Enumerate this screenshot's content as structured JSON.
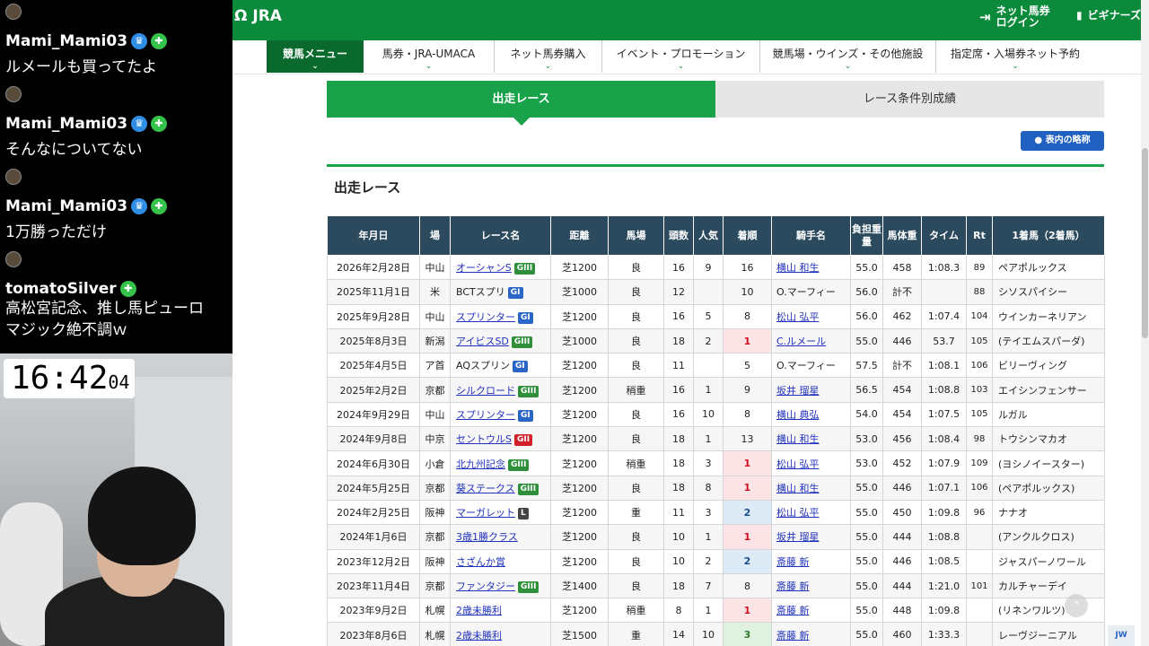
{
  "chat": {
    "messages": [
      {
        "user": "Mami_Mami03",
        "text": "ルメールも買ってたよ"
      },
      {
        "user": "Mami_Mami03",
        "text": "そんなについてない"
      },
      {
        "user": "Mami_Mami03",
        "text": "1万勝っただけ"
      },
      {
        "user": "tomatoSilver",
        "text_lines": [
          "高松宮記念、推し馬ピューロ",
          "マジック絶不調ｗ"
        ]
      }
    ],
    "clock": {
      "time": "16:42",
      "seconds": "04"
    }
  },
  "header": {
    "logo": "JRA",
    "login_line1": "ネット馬券",
    "login_line2": "ログイン",
    "beginner": "ビギナーズ"
  },
  "nav": {
    "items": [
      "競馬メニュー",
      "馬券・JRA-UMACA",
      "ネット馬券購入",
      "イベント・プロモーション",
      "競馬場・ウインズ・その他施設",
      "指定席・入場券ネット予約"
    ]
  },
  "tabs": {
    "entries": "出走レース",
    "results": "レース条件別成績"
  },
  "legend_button": "表内の略称",
  "section_title": "出走レース",
  "table": {
    "headers": [
      "年月日",
      "場",
      "レース名",
      "距離",
      "馬場",
      "頭数",
      "人気",
      "着順",
      "騎手名",
      "負担重量",
      "馬体重",
      "タイム",
      "Rt",
      "1着馬（2着馬）"
    ],
    "rows": [
      {
        "date": "2026年2月28日",
        "venue": "中山",
        "race": "オーシャンS",
        "grade": "GIII",
        "race_link": true,
        "distance": "芝1200",
        "going": "良",
        "runners": "16",
        "pop": "9",
        "pos": "16",
        "jockey": "横山 和生",
        "jockey_link": true,
        "weight": "55.0",
        "body": "458",
        "time": "1:08.3",
        "rt": "89",
        "winner": "ペアポルックス"
      },
      {
        "date": "2025年11月1日",
        "venue": "米",
        "race": "BCTスプリ",
        "grade": "GI",
        "race_link": false,
        "distance": "芝1000",
        "going": "良",
        "runners": "12",
        "pop": "",
        "pos": "10",
        "jockey": "O.マーフィー",
        "jockey_link": false,
        "weight": "56.0",
        "body": "計不",
        "time": "",
        "rt": "88",
        "winner": "シソスパイシー"
      },
      {
        "date": "2025年9月28日",
        "venue": "中山",
        "race": "スプリンター",
        "grade": "GI",
        "race_link": true,
        "distance": "芝1200",
        "going": "良",
        "runners": "16",
        "pop": "5",
        "pos": "8",
        "jockey": "松山 弘平",
        "jockey_link": true,
        "weight": "56.0",
        "body": "462",
        "time": "1:07.4",
        "rt": "104",
        "winner": "ウインカーネリアン"
      },
      {
        "date": "2025年8月3日",
        "venue": "新潟",
        "race": "アイビスSD",
        "grade": "GIII",
        "race_link": true,
        "distance": "芝1000",
        "going": "良",
        "runners": "18",
        "pop": "2",
        "pos": "1",
        "jockey": "C.ルメール",
        "jockey_link": true,
        "weight": "55.0",
        "body": "446",
        "time": "53.7",
        "rt": "105",
        "winner": "(テイエムスパーダ)"
      },
      {
        "date": "2025年4月5日",
        "venue": "ア首",
        "race": "AQスプリン",
        "grade": "GI",
        "race_link": false,
        "distance": "芝1200",
        "going": "良",
        "runners": "11",
        "pop": "",
        "pos": "5",
        "jockey": "O.マーフィー",
        "jockey_link": false,
        "weight": "57.5",
        "body": "計不",
        "time": "1:08.1",
        "rt": "106",
        "winner": "ビリーヴィング"
      },
      {
        "date": "2025年2月2日",
        "venue": "京都",
        "race": "シルクロード",
        "grade": "GIII",
        "race_link": true,
        "distance": "芝1200",
        "going": "稍重",
        "runners": "16",
        "pop": "1",
        "pos": "9",
        "jockey": "坂井 瑠星",
        "jockey_link": true,
        "weight": "56.5",
        "body": "454",
        "time": "1:08.8",
        "rt": "103",
        "winner": "エイシンフェンサー"
      },
      {
        "date": "2024年9月29日",
        "venue": "中山",
        "race": "スプリンター",
        "grade": "GI",
        "race_link": true,
        "distance": "芝1200",
        "going": "良",
        "runners": "16",
        "pop": "10",
        "pos": "8",
        "jockey": "横山 典弘",
        "jockey_link": true,
        "weight": "54.0",
        "body": "454",
        "time": "1:07.5",
        "rt": "105",
        "winner": "ルガル"
      },
      {
        "date": "2024年9月8日",
        "venue": "中京",
        "race": "セントウルS",
        "grade": "GII",
        "race_link": true,
        "distance": "芝1200",
        "going": "良",
        "runners": "18",
        "pop": "1",
        "pos": "13",
        "jockey": "横山 和生",
        "jockey_link": true,
        "weight": "53.0",
        "body": "456",
        "time": "1:08.4",
        "rt": "98",
        "winner": "トウシンマカオ"
      },
      {
        "date": "2024年6月30日",
        "venue": "小倉",
        "race": "北九州記念",
        "grade": "GIII",
        "race_link": true,
        "distance": "芝1200",
        "going": "稍重",
        "runners": "18",
        "pop": "3",
        "pos": "1",
        "jockey": "松山 弘平",
        "jockey_link": true,
        "weight": "53.0",
        "body": "452",
        "time": "1:07.9",
        "rt": "109",
        "winner": "(ヨシノイースター)"
      },
      {
        "date": "2024年5月25日",
        "venue": "京都",
        "race": "葵ステークス",
        "grade": "GIII",
        "race_link": true,
        "distance": "芝1200",
        "going": "良",
        "runners": "18",
        "pop": "8",
        "pos": "1",
        "jockey": "横山 和生",
        "jockey_link": true,
        "weight": "55.0",
        "body": "446",
        "time": "1:07.1",
        "rt": "106",
        "winner": "(ペアポルックス)"
      },
      {
        "date": "2024年2月25日",
        "venue": "阪神",
        "race": "マーガレット",
        "grade": "L",
        "race_link": true,
        "distance": "芝1200",
        "going": "重",
        "runners": "11",
        "pop": "3",
        "pos": "2",
        "jockey": "松山 弘平",
        "jockey_link": true,
        "weight": "55.0",
        "body": "450",
        "time": "1:09.8",
        "rt": "96",
        "winner": "ナナオ"
      },
      {
        "date": "2024年1月6日",
        "venue": "京都",
        "race": "3歳1勝クラス",
        "grade": "",
        "race_link": true,
        "distance": "芝1200",
        "going": "良",
        "runners": "10",
        "pop": "1",
        "pos": "1",
        "jockey": "坂井 瑠星",
        "jockey_link": true,
        "weight": "55.0",
        "body": "444",
        "time": "1:08.8",
        "rt": "",
        "winner": "(アンクルクロス)"
      },
      {
        "date": "2023年12月2日",
        "venue": "阪神",
        "race": "さざんか賞",
        "grade": "",
        "race_link": true,
        "distance": "芝1200",
        "going": "良",
        "runners": "10",
        "pop": "2",
        "pos": "2",
        "jockey": "斎藤 新",
        "jockey_link": true,
        "weight": "55.0",
        "body": "446",
        "time": "1:08.5",
        "rt": "",
        "winner": "ジャスパーノワール"
      },
      {
        "date": "2023年11月4日",
        "venue": "京都",
        "race": "ファンタジー",
        "grade": "GIII",
        "race_link": true,
        "distance": "芝1400",
        "going": "良",
        "runners": "18",
        "pop": "7",
        "pos": "8",
        "jockey": "斎藤 新",
        "jockey_link": true,
        "weight": "55.0",
        "body": "444",
        "time": "1:21.0",
        "rt": "101",
        "winner": "カルチャーデイ"
      },
      {
        "date": "2023年9月2日",
        "venue": "札幌",
        "race": "2歳未勝利",
        "grade": "",
        "race_link": true,
        "distance": "芝1200",
        "going": "稍重",
        "runners": "8",
        "pop": "1",
        "pos": "1",
        "jockey": "斎藤 新",
        "jockey_link": true,
        "weight": "55.0",
        "body": "448",
        "time": "1:09.8",
        "rt": "",
        "winner": "(リネンワルツ)"
      },
      {
        "date": "2023年8月6日",
        "venue": "札幌",
        "race": "2歳未勝利",
        "grade": "",
        "race_link": true,
        "distance": "芝1500",
        "going": "重",
        "runners": "14",
        "pop": "10",
        "pos": "3",
        "jockey": "斎藤 新",
        "jockey_link": true,
        "weight": "55.0",
        "body": "460",
        "time": "1:33.3",
        "rt": "",
        "winner": "レーヴジーニアル"
      }
    ]
  },
  "icons": {
    "login": "login-arrow-icon",
    "beginner": "book-icon",
    "to_top": "chevron-up-icon"
  },
  "colors": {
    "header_green": "#0a8a3a",
    "tab_green": "#1aa24a",
    "table_header": "#2b4a5e",
    "link_blue": "#2233bb"
  }
}
